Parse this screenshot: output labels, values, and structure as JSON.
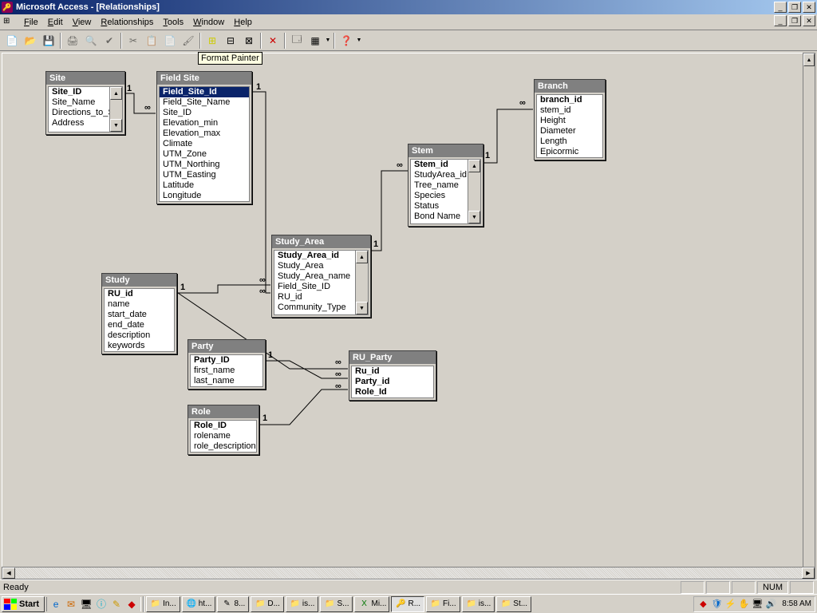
{
  "window": {
    "title": "Microsoft Access - [Relationships]",
    "tooltip": "Format Painter"
  },
  "menu": {
    "file": "File",
    "edit": "Edit",
    "view": "View",
    "relationships": "Relationships",
    "tools": "Tools",
    "window": "Window",
    "help": "Help"
  },
  "tables": {
    "site": {
      "title": "Site",
      "fields": [
        "Site_ID",
        "Site_Name",
        "Directions_to_Si",
        "Address"
      ],
      "pk": [
        0
      ]
    },
    "fieldsite": {
      "title": "Field Site",
      "fields": [
        "Field_Site_Id",
        "Field_Site_Name",
        "Site_ID",
        "Elevation_min",
        "Elevation_max",
        "Climate",
        "UTM_Zone",
        "UTM_Northing",
        "UTM_Easting",
        "Latitude",
        "Longitude"
      ],
      "pk": [
        0
      ],
      "selected": 0
    },
    "stem": {
      "title": "Stem",
      "fields": [
        "Stem_id",
        "StudyArea_id",
        "Tree_name",
        "Species",
        "Status",
        "Bond Name"
      ],
      "pk": [
        0
      ]
    },
    "branch": {
      "title": "Branch",
      "fields": [
        "branch_id",
        "stem_id",
        "Height",
        "Diameter",
        "Length",
        "Epicormic"
      ],
      "pk": [
        0
      ]
    },
    "studyarea": {
      "title": "Study_Area",
      "fields": [
        "Study_Area_id",
        "Study_Area",
        "Study_Area_name",
        "Field_Site_ID",
        "RU_id",
        "Community_Type"
      ],
      "pk": [
        0
      ]
    },
    "study": {
      "title": "Study",
      "fields": [
        "RU_id",
        "name",
        "start_date",
        "end_date",
        "description",
        "keywords"
      ],
      "pk": [
        0
      ]
    },
    "party": {
      "title": "Party",
      "fields": [
        "Party_ID",
        "first_name",
        "last_name"
      ],
      "pk": [
        0
      ]
    },
    "role": {
      "title": "Role",
      "fields": [
        "Role_ID",
        "rolename",
        "role_description"
      ],
      "pk": [
        0
      ]
    },
    "ruparty": {
      "title": "RU_Party",
      "fields": [
        "Ru_id",
        "Party_id",
        "Role_Id"
      ],
      "pk": [
        0,
        1,
        2
      ]
    }
  },
  "status": {
    "ready": "Ready",
    "num": "NUM"
  },
  "taskbar": {
    "start": "Start",
    "items": [
      "In...",
      "ht...",
      "8...",
      "D...",
      "is...",
      "S...",
      "Mi...",
      "R...",
      "Fi...",
      "is...",
      "St..."
    ],
    "clock": "8:58 AM"
  },
  "rel_symbols": {
    "one": "1",
    "inf": "∞"
  }
}
